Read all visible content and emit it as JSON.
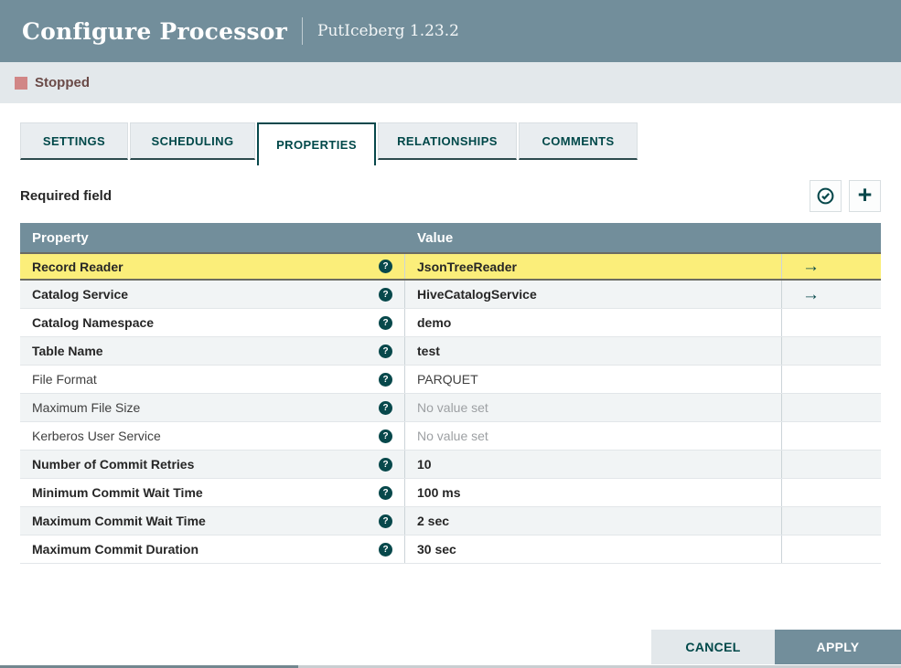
{
  "dialog": {
    "title": "Configure Processor",
    "subtitle": "PutIceberg 1.23.2",
    "status_label": "Stopped"
  },
  "tabs": [
    {
      "label": "SETTINGS",
      "active": false
    },
    {
      "label": "SCHEDULING",
      "active": false
    },
    {
      "label": "PROPERTIES",
      "active": true
    },
    {
      "label": "RELATIONSHIPS",
      "active": false
    },
    {
      "label": "COMMENTS",
      "active": false
    }
  ],
  "properties_panel": {
    "required_field_label": "Required field",
    "verify_button_icon": "checkmark-circle-icon",
    "add_button_icon": "plus-icon",
    "help_icon_glyph": "?",
    "go_to_icon_glyph": "→"
  },
  "table": {
    "columns": [
      "Property",
      "Value"
    ],
    "empty_value_text": "No value set",
    "rows": [
      {
        "property": "Record Reader",
        "value": "JsonTreeReader",
        "required": true,
        "highlighted": true,
        "empty": false,
        "go_to": true
      },
      {
        "property": "Catalog Service",
        "value": "HiveCatalogService",
        "required": true,
        "highlighted": false,
        "empty": false,
        "go_to": true
      },
      {
        "property": "Catalog Namespace",
        "value": "demo",
        "required": true,
        "highlighted": false,
        "empty": false,
        "go_to": false
      },
      {
        "property": "Table Name",
        "value": "test",
        "required": true,
        "highlighted": false,
        "empty": false,
        "go_to": false
      },
      {
        "property": "File Format",
        "value": "PARQUET",
        "required": false,
        "highlighted": false,
        "empty": false,
        "go_to": false
      },
      {
        "property": "Maximum File Size",
        "value": "No value set",
        "required": false,
        "highlighted": false,
        "empty": true,
        "go_to": false
      },
      {
        "property": "Kerberos User Service",
        "value": "No value set",
        "required": false,
        "highlighted": false,
        "empty": true,
        "go_to": false
      },
      {
        "property": "Number of Commit Retries",
        "value": "10",
        "required": true,
        "highlighted": false,
        "empty": false,
        "go_to": false
      },
      {
        "property": "Minimum Commit Wait Time",
        "value": "100 ms",
        "required": true,
        "highlighted": false,
        "empty": false,
        "go_to": false
      },
      {
        "property": "Maximum Commit Wait Time",
        "value": "2 sec",
        "required": true,
        "highlighted": false,
        "empty": false,
        "go_to": false
      },
      {
        "property": "Maximum Commit Duration",
        "value": "30 sec",
        "required": true,
        "highlighted": false,
        "empty": false,
        "go_to": false
      }
    ]
  },
  "footer": {
    "cancel_label": "CANCEL",
    "apply_label": "APPLY"
  },
  "colors": {
    "header_background": "#728e9b",
    "accent_teal": "#07484b",
    "status_bar_background": "#e3e8eb",
    "stopped_square": "#d18686",
    "stopped_text": "#6a4a47",
    "highlight_yellow": "#fbee7a",
    "row_stripe": "#f1f4f5",
    "apply_button_background": "#728e9b",
    "cancel_button_background": "#e3e8eb",
    "empty_value_gray": "#9da0a3"
  }
}
